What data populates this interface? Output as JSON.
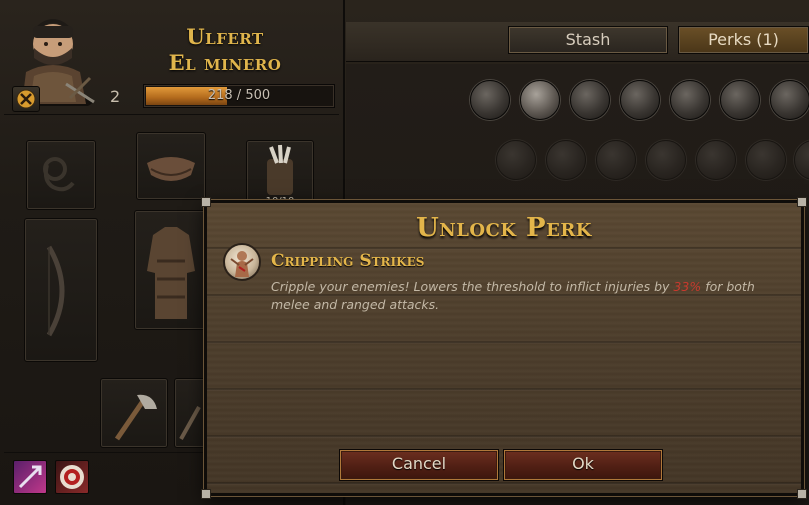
{
  "character": {
    "name_line1": "Ulfert",
    "name_line2": "El minero",
    "level": "2",
    "xp_text": "218 / 500",
    "xp_fraction": 0.436,
    "equipment": [
      {
        "slot": "ammo",
        "count": "10/10"
      }
    ]
  },
  "tabs": {
    "stash": "Stash",
    "perks": "Perks (1)"
  },
  "modal": {
    "title": "Unlock Perk",
    "perk_name": "Crippling Strikes",
    "desc_before": "Cripple your enemies! Lowers the threshold to inflict injuries by ",
    "desc_highlight": "33%",
    "desc_after": " for both melee and ranged attacks.",
    "cancel_label": "Cancel",
    "ok_label": "Ok"
  },
  "colors": {
    "accent_gold": "#e3b54a",
    "highlight_red": "#c83a2e",
    "xp_orange": "#d08a2e"
  }
}
